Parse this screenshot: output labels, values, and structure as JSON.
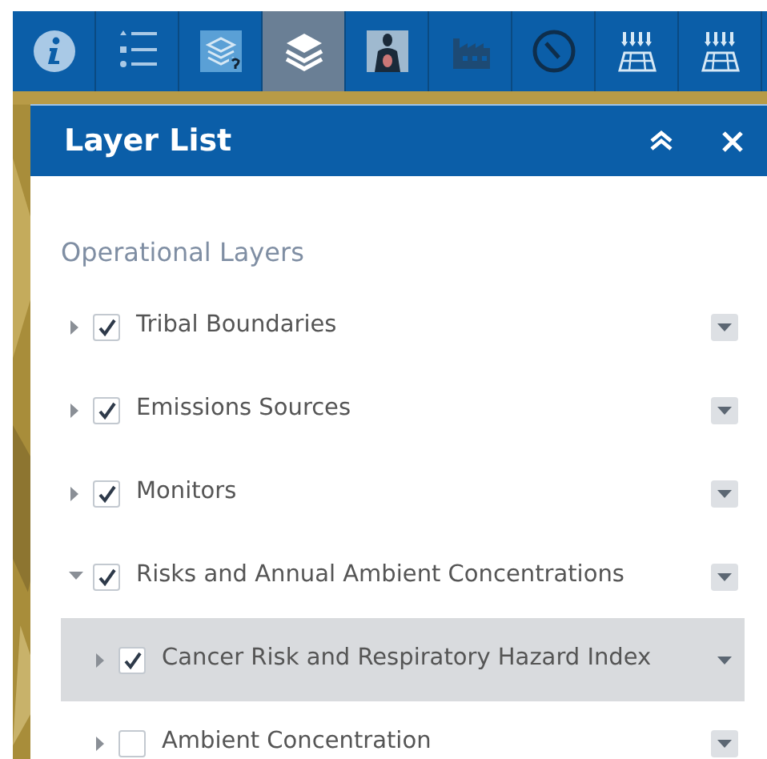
{
  "toolbar": [
    {
      "selected": false
    },
    {
      "selected": false
    },
    {
      "selected": false
    },
    {
      "selected": true
    },
    {
      "selected": false
    },
    {
      "selected": false
    },
    {
      "selected": false
    },
    {
      "selected": false
    },
    {
      "selected": false
    }
  ],
  "panel": {
    "title": "Layer List",
    "section": "Operational Layers",
    "layers": [
      {
        "label": "Tribal Boundaries",
        "checked": true,
        "expanded": false,
        "selected": false
      },
      {
        "label": "Emissions Sources",
        "checked": true,
        "expanded": false,
        "selected": false
      },
      {
        "label": "Monitors",
        "checked": true,
        "expanded": false,
        "selected": false
      },
      {
        "label": "Risks and Annual Ambient Concentrations",
        "checked": true,
        "expanded": true,
        "selected": false,
        "children": [
          {
            "label": "Cancer Risk and Respiratory Hazard Index",
            "checked": true,
            "expanded": false,
            "selected": true
          },
          {
            "label": "Ambient Concentration",
            "checked": false,
            "expanded": false,
            "selected": false
          }
        ]
      }
    ]
  }
}
